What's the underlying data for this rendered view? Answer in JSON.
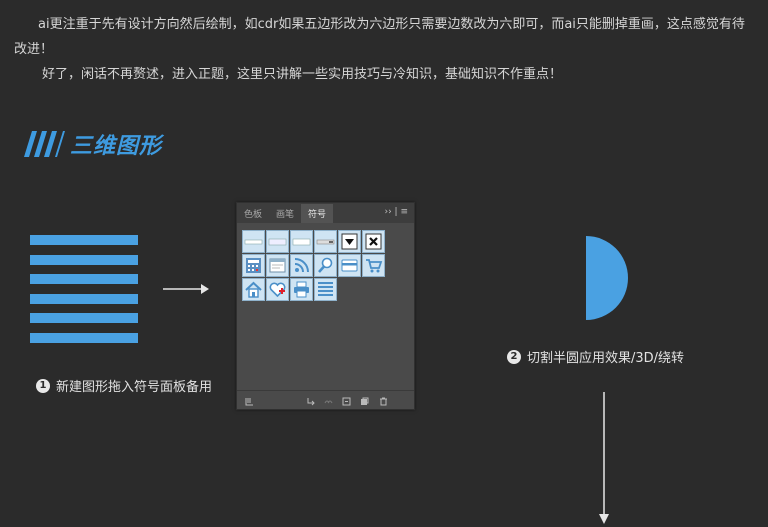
{
  "intro": {
    "p1": "ai更注重于先有设计方向然后绘制，如cdr如果五边形改为六边形只需要边数改为六即可，而ai只能删掉重画，这点感觉有待改进！",
    "p2": "好了，闲话不再赘述，进入正题，这里只讲解一些实用技巧与冷知识，基础知识不作重点！"
  },
  "section": {
    "title": "三维图形",
    "accent": "#3e9be0"
  },
  "panel": {
    "tabs": [
      "色板",
      "画笔",
      "符号"
    ],
    "active_tab": "符号",
    "menu_glyph": "›› | ≡",
    "symbols": [
      "banner-1",
      "banner-2",
      "banner-3",
      "banner-4",
      "dropdown",
      "close",
      "calculator",
      "browser-window",
      "rss",
      "magnifier",
      "credit-card",
      "cart",
      "home",
      "heart-plus",
      "printer",
      "list"
    ]
  },
  "steps": [
    {
      "number": "1",
      "label": "新建图形拖入符号面板备用"
    },
    {
      "number": "2",
      "label": "切割半圆应用效果/3D/绕转"
    }
  ],
  "colors": {
    "blue": "#4aa1e2",
    "background": "#2b2b2b"
  }
}
